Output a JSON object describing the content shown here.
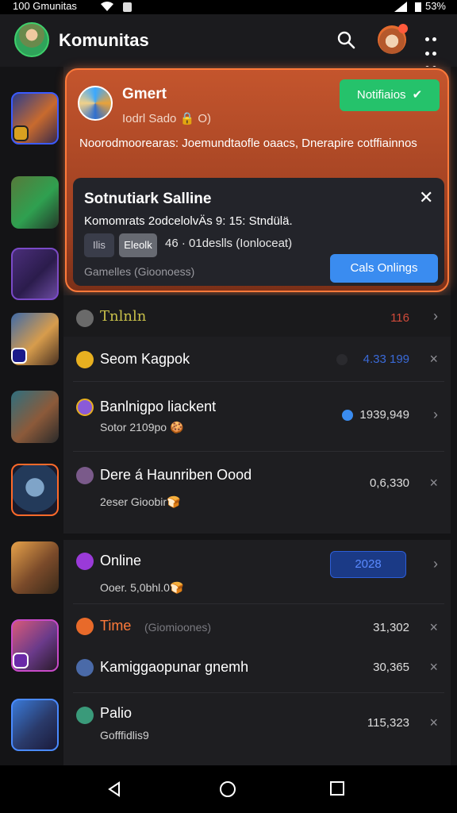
{
  "status": {
    "time": "100 Gmunitas",
    "battery": "53%"
  },
  "appbar": {
    "title": "Komunitas"
  },
  "notification": {
    "title": "Gmert",
    "subtitle": "Iodrl Sado 🔒 O)",
    "accept_label": "Notifiaios",
    "body": "Noorodmoorearas: Joemundtaofle oaacs, Dnerapire cotffiainnos",
    "inner": {
      "title": "Sotnutiark Salline",
      "text": "Komomrats 2odcelolvÄs 9: 15: Stndülä.",
      "chip1": "Ilis",
      "chip2": "Eleolk",
      "count": "46 · 01deslls (Ionloceat)",
      "footer": "Gamelles  (Gioonoess)",
      "button": "Cals Onlings"
    }
  },
  "rows": [
    {
      "name": "Tnlnln",
      "value": "116",
      "action": "›"
    },
    {
      "name": "Seom Kagpok",
      "value": "4.33 199",
      "action": "×"
    },
    {
      "name": "Banlnigpo liackent",
      "sub": "Sotor 2109po 🍪",
      "value": "1939,949",
      "action": "›"
    },
    {
      "name": "Dere á Haunriben Oood",
      "sub": "2eser Gioobir🍞",
      "value": "0,6,330",
      "action": "×"
    },
    {
      "name": "Online",
      "sub": "Ooer. 5,0bhl.0🍞",
      "value": "2028",
      "action": "›"
    },
    {
      "name": "Time",
      "sub": "(Giomioones)",
      "value": "31,302",
      "action": "×"
    },
    {
      "name": "Kamiggaopunar gnemh",
      "value": "30,365",
      "action": "×"
    },
    {
      "name": "Palio",
      "sub": "Gofffidlis9",
      "value": "115,323",
      "action": "×"
    }
  ]
}
